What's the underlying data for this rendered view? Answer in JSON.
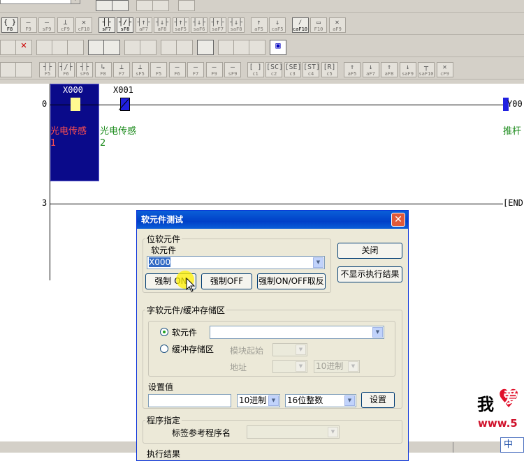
{
  "toolbar": {
    "row2": [
      {
        "sym": "{ }",
        "label": "F8",
        "active": true
      },
      {
        "sym": "—",
        "label": "F9",
        "active": false
      },
      {
        "sym": "—",
        "label": "sF9",
        "active": false
      },
      {
        "sym": "⊥",
        "label": "cF9",
        "active": false
      },
      {
        "sym": "✕",
        "label": "cF10",
        "active": false
      },
      {
        "sym": "┤├",
        "label": "sF7",
        "active": true
      },
      {
        "sym": "┤/├",
        "label": "sF8",
        "active": true
      },
      {
        "sym": "┤↑├",
        "label": "aF7",
        "active": false
      },
      {
        "sym": "┤↓├",
        "label": "aF8",
        "active": false
      },
      {
        "sym": "┤↑├",
        "label": "saF5",
        "active": false
      },
      {
        "sym": "┤↓├",
        "label": "saF6",
        "active": false
      },
      {
        "sym": "┤↑├",
        "label": "saF7",
        "active": false
      },
      {
        "sym": "┤↓├",
        "label": "saF8",
        "active": false
      },
      {
        "sym": "↑",
        "label": "aF5",
        "active": false
      },
      {
        "sym": "↓",
        "label": "caF5",
        "active": false
      },
      {
        "sym": "⁄",
        "label": "caF10",
        "active": true
      },
      {
        "sym": "▭",
        "label": "F10",
        "active": false
      },
      {
        "sym": "⨯",
        "label": "aF9",
        "active": false
      }
    ],
    "row4": [
      {
        "sym": "┤├",
        "label": "F5"
      },
      {
        "sym": "┤/├",
        "label": "F6"
      },
      {
        "sym": "┤├",
        "label": "sF6"
      },
      {
        "sym": "↳",
        "label": "F8"
      },
      {
        "sym": "⊥",
        "label": "F7"
      },
      {
        "sym": "⊥",
        "label": "sF5"
      },
      {
        "sym": "—",
        "label": "F5"
      },
      {
        "sym": "—",
        "label": "F6"
      },
      {
        "sym": "—",
        "label": "F7"
      },
      {
        "sym": "—",
        "label": "F9"
      },
      {
        "sym": "—",
        "label": "sF9"
      },
      {
        "sym": "[ ]",
        "label": "c1"
      },
      {
        "sym": "[SC]",
        "label": "c2"
      },
      {
        "sym": "[SE]",
        "label": "c3"
      },
      {
        "sym": "[ST]",
        "label": "c4"
      },
      {
        "sym": "[R]",
        "label": "c5"
      },
      {
        "sym": "↑",
        "label": "aF5"
      },
      {
        "sym": "↓",
        "label": "aF7"
      },
      {
        "sym": "↑",
        "label": "aF8"
      },
      {
        "sym": "↓",
        "label": "saF9"
      },
      {
        "sym": "┬",
        "label": "saF10"
      },
      {
        "sym": "✕",
        "label": "cF9"
      }
    ]
  },
  "ladder": {
    "step_0": "0",
    "step_3": "3",
    "contact_x000": "X000",
    "contact_x001": "X001",
    "comment_x000_line1": "光电传感",
    "comment_x000_line2": "1",
    "comment_x001_line1": "光电传感",
    "comment_x001_line2": "2",
    "coil_y": "Y00",
    "comment_coil": "推杆",
    "end_instruction": "END"
  },
  "dialog": {
    "title": "软元件测试",
    "bit_group": "位软元件",
    "device_label": "软元件",
    "device_value": "X000",
    "force_on": "强制 ON",
    "force_off": "强制OFF",
    "force_toggle": "强制ON/OFF取反",
    "close": "关闭",
    "hide_results": "不显示执行结果",
    "word_group": "字软元件/缓冲存储区",
    "radio_device": "软元件",
    "radio_buffer": "缓冲存储区",
    "module_start": "模块起始",
    "address": "地址",
    "address_base": "10进制",
    "set_value_label": "设置值",
    "set_value_base": "10进制",
    "set_value_type": "16位整数",
    "set_button": "设置",
    "program_group": "程序指定",
    "label_ref": "标签参考程序名",
    "exec_result": "执行结果"
  },
  "watermark": {
    "text1": "我",
    "text2": "爱",
    "url": "www.5"
  },
  "ime": "中"
}
